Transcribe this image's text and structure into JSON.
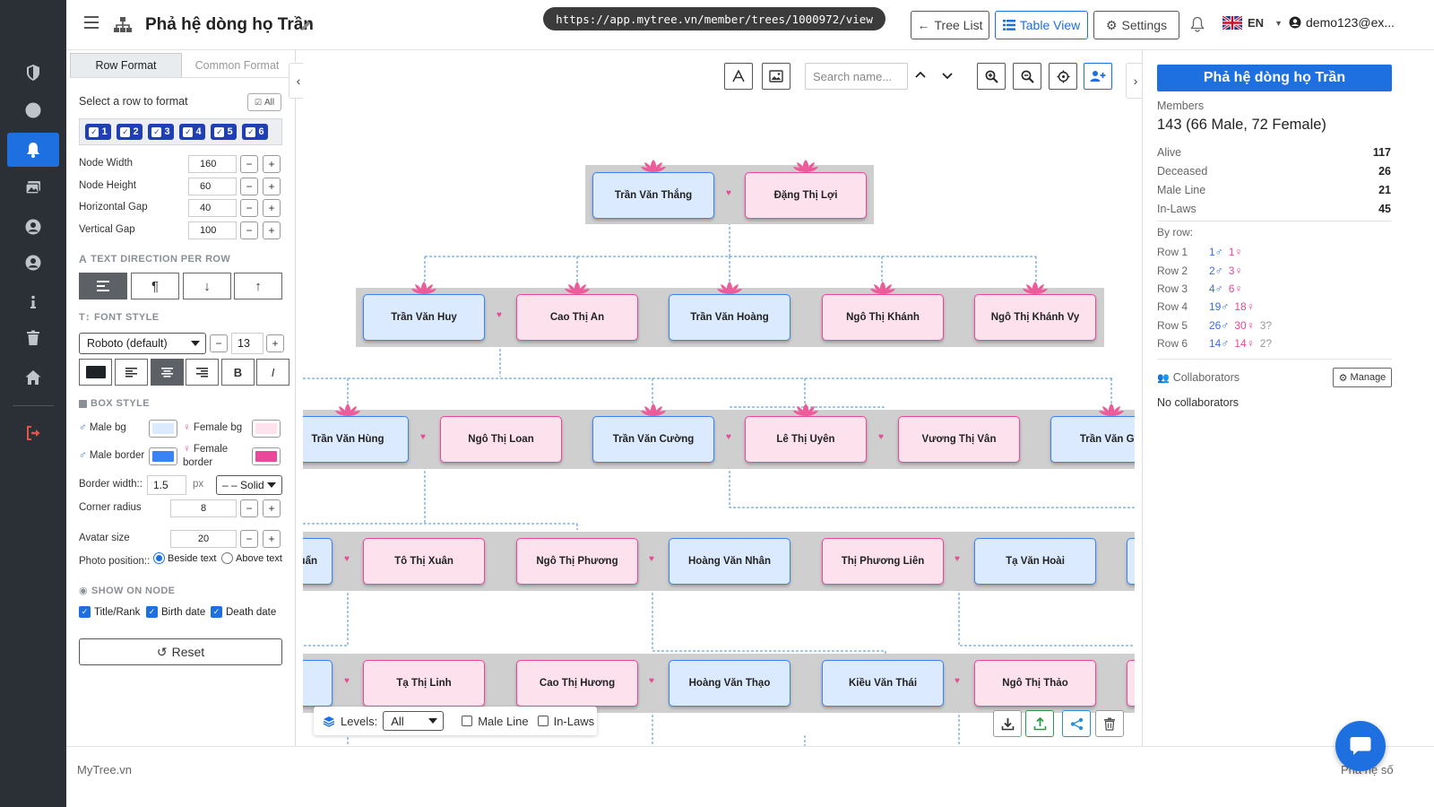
{
  "header": {
    "title": "Phả hệ dòng họ Trần",
    "url": "https://app.mytree.vn/member/trees/1000972/view",
    "tree_list_label": "Tree List",
    "table_view_label": "Table View",
    "settings_label": "Settings",
    "lang": "EN",
    "user": "demo123@ex..."
  },
  "left_panel": {
    "tabs": [
      "Row Format",
      "Common Format"
    ],
    "select_row_label": "Select a row to format",
    "all_label": "All",
    "rows": [
      "1",
      "2",
      "3",
      "4",
      "5",
      "6"
    ],
    "node_width_label": "Node Width",
    "node_width": "160",
    "node_height_label": "Node Height",
    "node_height": "60",
    "h_gap_label": "Horizontal Gap",
    "h_gap": "40",
    "v_gap_label": "Vertical Gap",
    "v_gap": "100",
    "text_direction_heading": "TEXT DIRECTION PER ROW",
    "font_style_heading": "FONT STYLE",
    "font_family": "Roboto (default)",
    "font_size": "13",
    "bold_label": "B",
    "italic_label": "I",
    "box_style_heading": "BOX STYLE",
    "male_bg_label": "Male bg",
    "female_bg_label": "Female bg",
    "male_border_label": "Male border",
    "female_border_label": "Female border",
    "male_bg_color": "#dbeafe",
    "female_bg_color": "#fde2ee",
    "male_border_color": "#3b82f6",
    "female_border_color": "#ec4899",
    "border_width_label": "Border width::",
    "border_width": "1.5",
    "border_unit": "px",
    "border_style": "– – Solid",
    "corner_radius_label": "Corner radius",
    "corner_radius": "8",
    "avatar_size_label": "Avatar size",
    "avatar_size": "20",
    "photo_position_label": "Photo position::",
    "photo_beside": "Beside text",
    "photo_above": "Above text",
    "show_on_node_heading": "SHOW ON NODE",
    "show_title": "Title/Rank",
    "show_birth": "Birth date",
    "show_death": "Death date",
    "reset_label": "Reset"
  },
  "canvas": {
    "search_placeholder": "Search name...",
    "levels_label": "Levels:",
    "levels_value": "All",
    "male_line_label": "Male Line",
    "in_laws_label": "In-Laws",
    "row1": [
      "Trần Văn Thắng",
      "Đặng Thị Lợi"
    ],
    "row2": [
      "Trần Văn Huy",
      "Cao Thị An",
      "Trần Văn Hoàng",
      "Ngô Thị Khánh",
      "Ngô Thị Khánh Vy"
    ],
    "row3": [
      "Trần Văn Hùng",
      "Ngô Thị Loan",
      "Trần Văn Cường",
      "Lê Thị Uyên",
      "Vương Thị Vân",
      "Trần Văn Gia"
    ],
    "row4": [
      "uấn",
      "Tô Thị Xuân",
      "Ngô Thị Phương",
      "Hoàng Văn Nhân",
      "Thị Phương Liên",
      "Tạ Văn Hoài"
    ],
    "row5": [
      "Tạ Thị Linh",
      "Cao Thị Hương",
      "Hoàng Văn Thạo",
      "Kiều Văn Thái",
      "Ngô Thị Thảo"
    ]
  },
  "right_panel": {
    "title": "Phả hệ dòng họ Trần",
    "members_label": "Members",
    "members_value": "143 (66 Male, 72 Female)",
    "alive_label": "Alive",
    "alive": "117",
    "deceased_label": "Deceased",
    "deceased": "26",
    "male_line_label": "Male Line",
    "male_line": "21",
    "in_laws_label": "In-Laws",
    "in_laws": "45",
    "by_row_label": "By row:",
    "by_row": [
      {
        "label": "Row 1",
        "m": "1♂",
        "f": "1♀",
        "u": ""
      },
      {
        "label": "Row 2",
        "m": "2♂",
        "f": "3♀",
        "u": ""
      },
      {
        "label": "Row 3",
        "m": "4♂",
        "f": "6♀",
        "u": ""
      },
      {
        "label": "Row 4",
        "m": "19♂",
        "f": "18♀",
        "u": ""
      },
      {
        "label": "Row 5",
        "m": "26♂",
        "f": "30♀",
        "u": "3?"
      },
      {
        "label": "Row 6",
        "m": "14♂",
        "f": "14♀",
        "u": "2?"
      }
    ],
    "collaborators_label": "Collaborators",
    "manage_label": "Manage",
    "no_collaborators": "No collaborators"
  },
  "footer": {
    "brand": "MyTree.vn",
    "right": "Phả hệ số"
  }
}
